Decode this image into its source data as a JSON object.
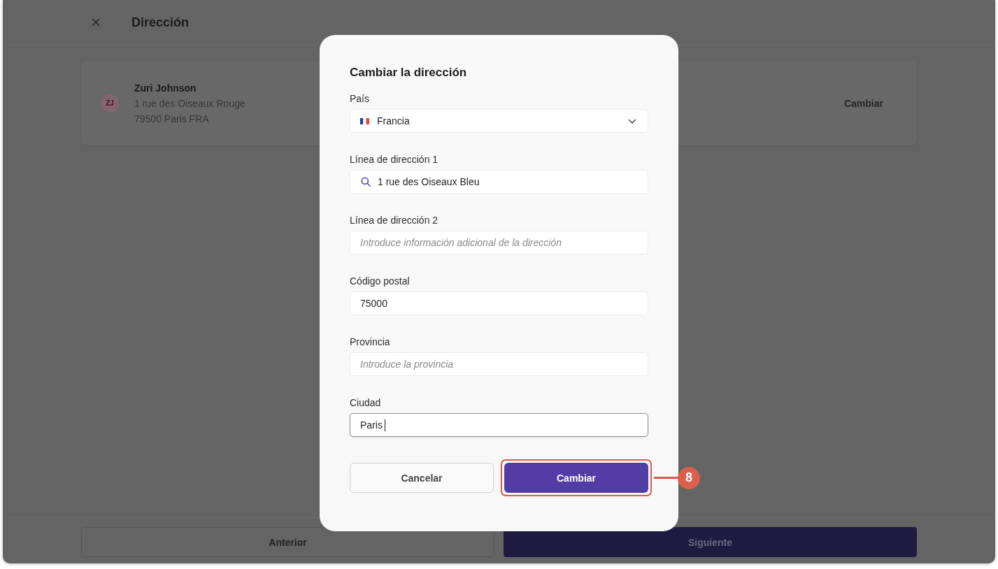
{
  "window": {
    "title": "Dirección"
  },
  "address_card": {
    "initials": "ZJ",
    "name": "Zuri Johnson",
    "lines": [
      "1 rue des Oiseaux Rouge",
      "79500 Paris FRA"
    ],
    "action": "Cambiar"
  },
  "footer": {
    "buttons": [
      {
        "label": "Anterior",
        "kind": "secondary"
      },
      {
        "label": "Siguiente",
        "kind": "primary"
      }
    ]
  },
  "dialog": {
    "title": "Cambiar la dirección",
    "fields": [
      {
        "kind": "select",
        "label": "País",
        "value": "Francia",
        "focused": false
      },
      {
        "kind": "search",
        "label": "Línea de dirección 1",
        "value": "1 rue des Oiseaux Bleu",
        "focused": false
      },
      {
        "kind": "text",
        "label": "Línea de dirección 2",
        "placeholder": "Introduce información adicional de la dirección",
        "focused": false
      },
      {
        "kind": "text",
        "label": "Código postal",
        "value": "75000",
        "focused": false
      },
      {
        "kind": "text",
        "label": "Provincia",
        "placeholder": "Introduce la provincia",
        "focused": false
      },
      {
        "kind": "text",
        "label": "Ciudad",
        "value": "Paris",
        "focused": true
      }
    ],
    "buttons": [
      {
        "label": "Cancelar",
        "kind": "secondary",
        "highlighted": false
      },
      {
        "label": "Cambiar",
        "kind": "primary",
        "highlighted": true
      }
    ]
  },
  "callout": {
    "label": "8"
  }
}
